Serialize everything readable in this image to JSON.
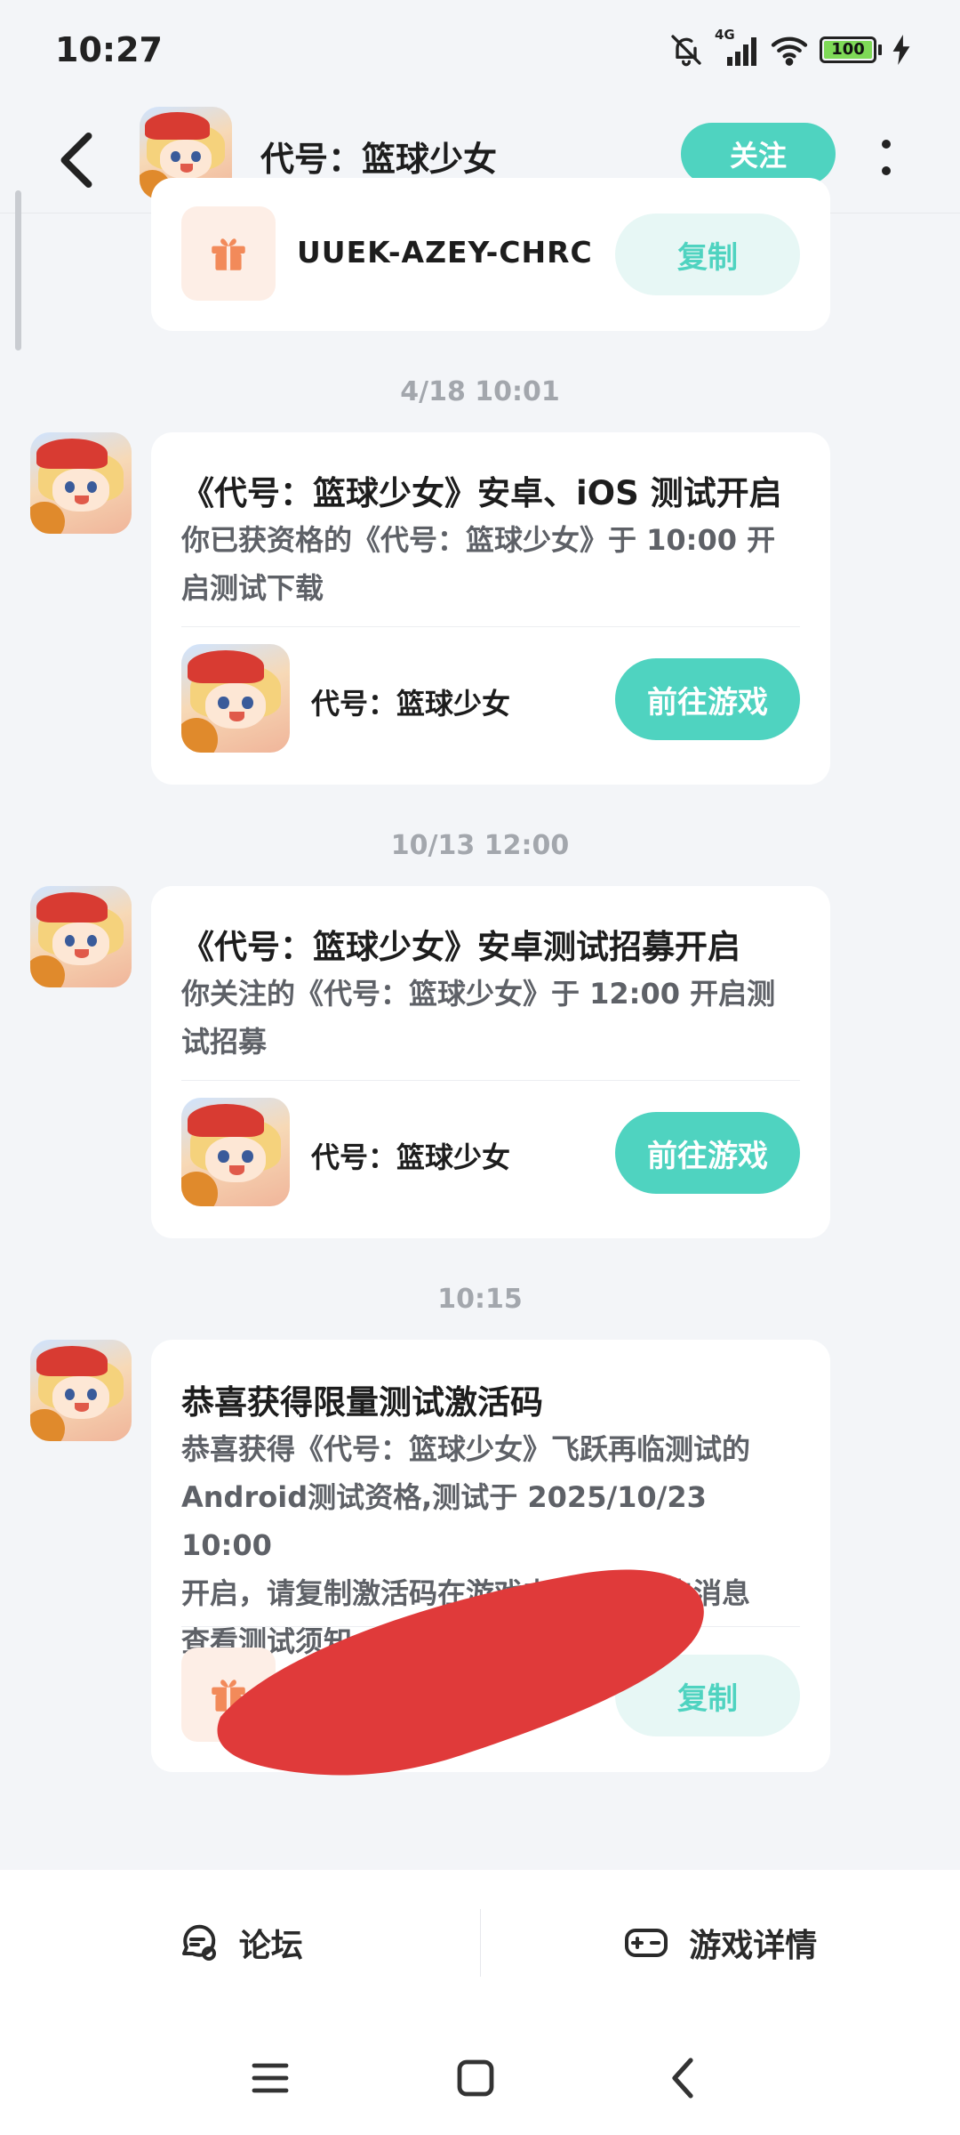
{
  "status_bar": {
    "time": "10:27",
    "network": "4G",
    "battery": "100",
    "icons": [
      "bell-off-icon",
      "signal-icon",
      "wifi-icon",
      "battery-icon",
      "charging-icon"
    ]
  },
  "header": {
    "title": "代号：篮球少女",
    "follow_label": "关注",
    "back_icon": "back-icon",
    "more_icon": "more-icon"
  },
  "messages": [
    {
      "code": "UUEK-AZEY-CHRC",
      "copy_label": "复制",
      "gift_icon": "gift-icon"
    },
    {
      "timestamp": "4/18  10:01",
      "title": "《代号：篮球少女》安卓、iOS 测试开启",
      "body": "你已获资格的《代号：篮球少女》于 10:00 开启测试下载",
      "game_name": "代号：篮球少女",
      "action_label": "前往游戏"
    },
    {
      "timestamp": "10/13  12:00",
      "title": "《代号：篮球少女》安卓测试招募开启",
      "body": "你关注的《代号：篮球少女》于 12:00 开启测试招募",
      "game_name": "代号：篮球少女",
      "action_label": "前往游戏"
    },
    {
      "timestamp": "10:15",
      "title": "恭喜获得限量测试激活码",
      "body_lines": [
        "恭喜获得《代号：篮球少女》飞跃再临测试的",
        "Android测试资格,测试于 2025/10/23 10:00",
        "开启，请复制激活码在游戏内使用，点击消息",
        "查看测试须知"
      ],
      "copy_label": "复制",
      "gift_icon": "gift-icon"
    }
  ],
  "bottom_tabs": [
    {
      "label": "论坛",
      "icon": "forum-icon"
    },
    {
      "label": "游戏详情",
      "icon": "gamepad-icon"
    }
  ],
  "nav_bar": {
    "icons": [
      "menu-icon",
      "home-icon",
      "back-nav-icon"
    ]
  },
  "colors": {
    "accent": "#4fd3c0",
    "accent_light": "#e7f7f5",
    "background": "#f3f5f8",
    "gift_bg": "#fdeee6",
    "gift_icon": "#f28a5a",
    "redaction": "#e03a3a"
  }
}
